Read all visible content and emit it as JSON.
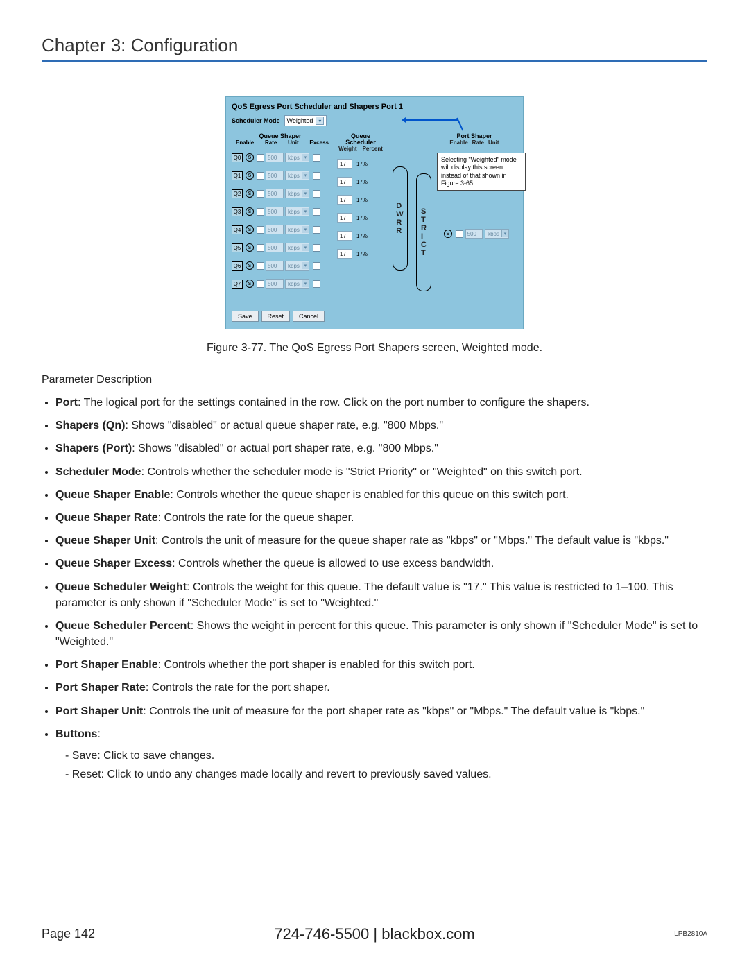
{
  "chapter": "Chapter 3: Configuration",
  "figure": {
    "title": "QoS Egress Port Scheduler and Shapers  Port 1",
    "sched_label": "Scheduler Mode",
    "sched_value": "Weighted",
    "note": "Selecting \"Weighted\" mode will display this screen instead of that shown in Figure 3-65.",
    "queue_shaper": {
      "heading": "Queue Shaper",
      "cols": [
        "Enable",
        "Rate",
        "Unit",
        "Excess"
      ],
      "rows": [
        {
          "q": "Q0",
          "rate": "500",
          "unit": "kbps"
        },
        {
          "q": "Q1",
          "rate": "500",
          "unit": "kbps"
        },
        {
          "q": "Q2",
          "rate": "500",
          "unit": "kbps"
        },
        {
          "q": "Q3",
          "rate": "500",
          "unit": "kbps"
        },
        {
          "q": "Q4",
          "rate": "500",
          "unit": "kbps"
        },
        {
          "q": "Q5",
          "rate": "500",
          "unit": "kbps"
        },
        {
          "q": "Q6",
          "rate": "500",
          "unit": "kbps"
        },
        {
          "q": "Q7",
          "rate": "500",
          "unit": "kbps"
        }
      ]
    },
    "queue_sched": {
      "heading": "Queue Scheduler",
      "cols": [
        "Weight",
        "Percent"
      ],
      "rows": [
        {
          "weight": "17",
          "percent": "17%"
        },
        {
          "weight": "17",
          "percent": "17%"
        },
        {
          "weight": "17",
          "percent": "17%"
        },
        {
          "weight": "17",
          "percent": "17%"
        },
        {
          "weight": "17",
          "percent": "17%"
        },
        {
          "weight": "17",
          "percent": "17%"
        }
      ]
    },
    "dwrr_label": "DWRR",
    "strict_label": "STRICT",
    "port_shaper": {
      "heading": "Port Shaper",
      "cols": [
        "Enable",
        "Rate",
        "Unit"
      ],
      "rate": "500",
      "unit": "kbps"
    },
    "buttons": {
      "save": "Save",
      "reset": "Reset",
      "cancel": "Cancel"
    }
  },
  "caption": "Figure 3-77. The QoS Egress Port Shapers screen, Weighted mode.",
  "param_head": "Parameter Description",
  "params": [
    {
      "term": "Port",
      "text": ": The logical port for the settings contained in the row. Click on the port number to configure the shapers."
    },
    {
      "term": "Shapers (Qn)",
      "text": ": Shows \"disabled\" or actual queue shaper rate, e.g. \"800 Mbps.\""
    },
    {
      "term": "Shapers (Port)",
      "text": ": Shows \"disabled\" or actual port shaper rate, e.g. \"800 Mbps.\""
    },
    {
      "term": "Scheduler Mode",
      "text": ": Controls whether the scheduler mode is \"Strict Priority\" or \"Weighted\" on this switch port."
    },
    {
      "term": "Queue Shaper Enable",
      "text": ": Controls whether the queue shaper is enabled for this queue on this switch port."
    },
    {
      "term": "Queue Shaper Rate",
      "text": ": Controls the rate for the queue shaper."
    },
    {
      "term": "Queue Shaper Unit",
      "text": ": Controls the unit of measure for the queue shaper rate as \"kbps\" or \"Mbps.\" The default value is \"kbps.\""
    },
    {
      "term": "Queue Shaper Excess",
      "text": ": Controls whether the queue is allowed to use excess bandwidth."
    },
    {
      "term": "Queue Scheduler Weight",
      "text": ": Controls the weight for this queue. The default value is \"17.\" This value is restricted to 1–100. This parameter is only shown if \"Scheduler Mode\" is set to \"Weighted.\""
    },
    {
      "term": "Queue Scheduler Percent",
      "text": ": Shows the weight in percent for this queue. This parameter is only shown if \"Scheduler Mode\" is set to \"Weighted.\""
    },
    {
      "term": "Port Shaper Enable",
      "text": ": Controls whether the port shaper is enabled for this switch port."
    },
    {
      "term": "Port Shaper Rate",
      "text": ": Controls the rate for the port shaper."
    },
    {
      "term": "Port Shaper Unit",
      "text": ": Controls the unit of measure for the port shaper rate as \"kbps\" or \"Mbps.\" The default value is \"kbps.\""
    }
  ],
  "buttons_term": "Buttons",
  "buttons_sub": [
    "- Save: Click to save changes.",
    "- Reset: Click to undo any changes made locally and revert to previously saved values."
  ],
  "footer": {
    "page": "Page 142",
    "center": "724-746-5500   |   blackbox.com",
    "right": "LPB2810A"
  }
}
